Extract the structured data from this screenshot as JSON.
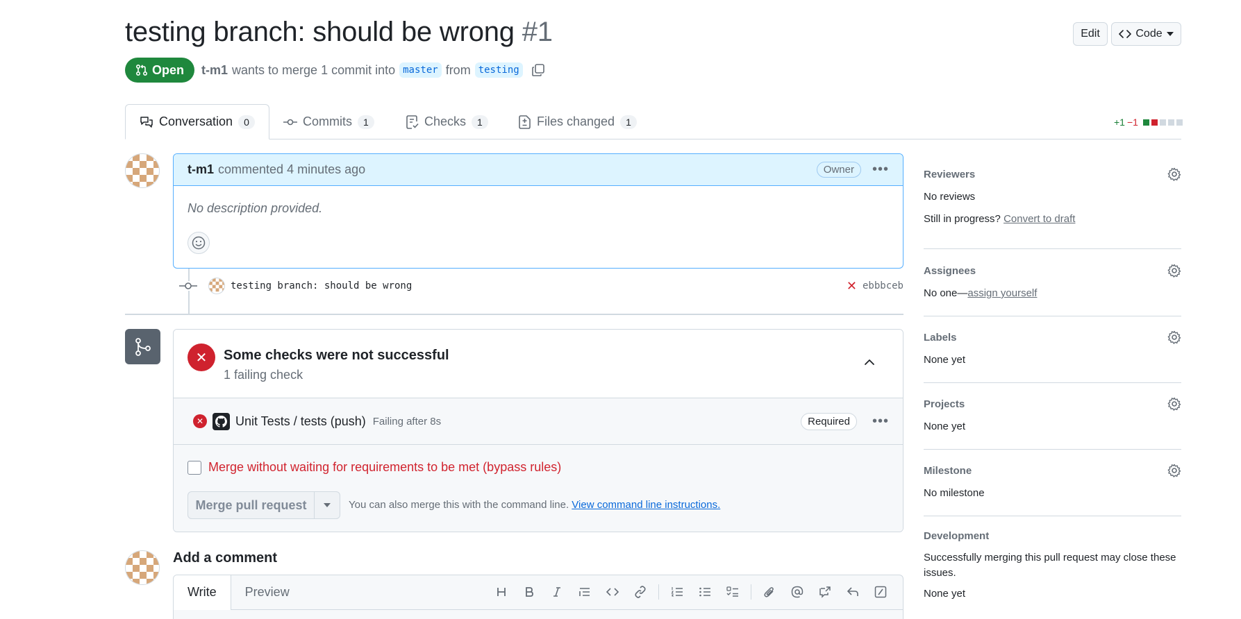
{
  "header": {
    "title": "testing branch: should be wrong",
    "number": "#1",
    "edit_label": "Edit",
    "code_label": "Code",
    "state": "Open",
    "author": "t-m1",
    "merge_text": "wants to merge 1 commit into",
    "base_branch": "master",
    "from_text": "from",
    "head_branch": "testing"
  },
  "tabs": [
    {
      "label": "Conversation",
      "count": "0"
    },
    {
      "label": "Commits",
      "count": "1"
    },
    {
      "label": "Checks",
      "count": "1"
    },
    {
      "label": "Files changed",
      "count": "1"
    }
  ],
  "diffstat": {
    "additions": "+1",
    "deletions": "−1"
  },
  "comment": {
    "author": "t-m1",
    "action": "commented",
    "time": "4 minutes ago",
    "role": "Owner",
    "body": "No description provided."
  },
  "commit": {
    "message": "testing branch: should be wrong",
    "sha": "ebbbceb"
  },
  "merge_box": {
    "title": "Some checks were not successful",
    "subtitle": "1 failing check",
    "check_name": "Unit Tests / tests (push)",
    "check_status": "Failing after 8s",
    "required_label": "Required",
    "bypass_label": "Merge without waiting for requirements to be met (bypass rules)",
    "merge_button": "Merge pull request",
    "cli_text": "You can also merge this with the command line.",
    "cli_link": "View command line instructions."
  },
  "add_comment": {
    "title": "Add a comment",
    "write_tab": "Write",
    "preview_tab": "Preview"
  },
  "sidebar": {
    "reviewers": {
      "title": "Reviewers",
      "value": "No reviews",
      "progress_text": "Still in progress?",
      "draft_link": "Convert to draft"
    },
    "assignees": {
      "title": "Assignees",
      "value": "No one—",
      "link": "assign yourself"
    },
    "labels": {
      "title": "Labels",
      "value": "None yet"
    },
    "projects": {
      "title": "Projects",
      "value": "None yet"
    },
    "milestone": {
      "title": "Milestone",
      "value": "No milestone"
    },
    "development": {
      "title": "Development",
      "description": "Successfully merging this pull request may close these issues.",
      "value": "None yet"
    }
  },
  "colors": {
    "open_green": "#1f883d",
    "fail_red": "#cf222e",
    "link_blue": "#0969da",
    "comment_header": "#ddf4ff"
  }
}
